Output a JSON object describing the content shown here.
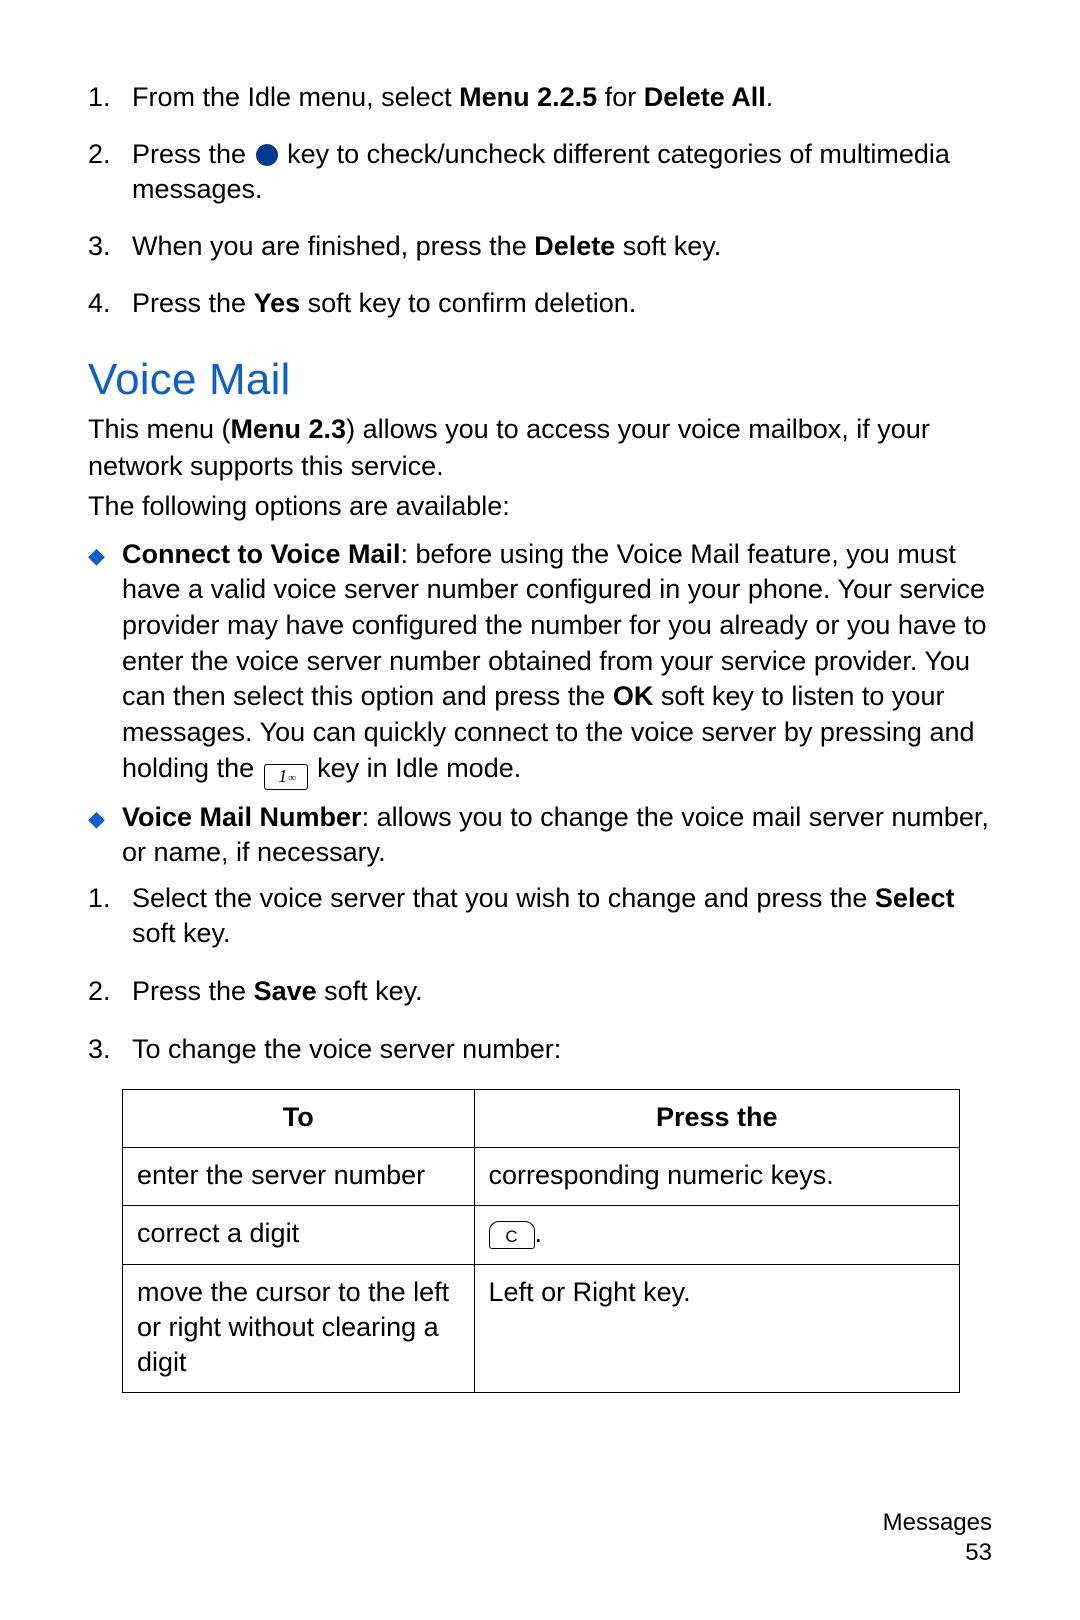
{
  "top_steps": [
    {
      "num": "1.",
      "parts": [
        {
          "t": "From the Idle menu, select "
        },
        {
          "t": "Menu 2.2.5",
          "b": true
        },
        {
          "t": " for "
        },
        {
          "t": "Delete All",
          "b": true
        },
        {
          "t": "."
        }
      ]
    },
    {
      "num": "2.",
      "parts": [
        {
          "t": "Press the "
        },
        {
          "icon": "circle"
        },
        {
          "t": " key to check/uncheck different categories of multimedia messages."
        }
      ]
    },
    {
      "num": "3.",
      "parts": [
        {
          "t": "When you are finished, press the "
        },
        {
          "t": "Delete",
          "b": true
        },
        {
          "t": " soft key."
        }
      ]
    },
    {
      "num": "4.",
      "parts": [
        {
          "t": "Press the "
        },
        {
          "t": "Yes",
          "b": true
        },
        {
          "t": " soft key to confirm deletion."
        }
      ]
    }
  ],
  "heading": "Voice Mail",
  "intro_parts": [
    {
      "t": "This menu ("
    },
    {
      "t": "Menu 2.3",
      "b": true
    },
    {
      "t": ") allows you to access your voice mailbox, if your network supports this service."
    }
  ],
  "intro2": "The following options are available:",
  "bullets": [
    {
      "parts": [
        {
          "t": "Connect to Voice Mail",
          "b": true
        },
        {
          "t": ": before using the Voice Mail feature, you must have a valid voice server number configured in your phone. Your service provider may have configured the number for you already or you have to enter the voice server number obtained from your service provider. You can then select this option and press the "
        },
        {
          "t": "OK",
          "b": true
        },
        {
          "t": " soft key to listen to your messages. You can quickly connect to the voice server by pressing and holding the "
        },
        {
          "icon": "one"
        },
        {
          "t": " key in Idle mode."
        }
      ]
    },
    {
      "parts": [
        {
          "t": "Voice Mail Number",
          "b": true
        },
        {
          "t": ": allows you to change the voice mail server number, or name, if necessary."
        }
      ]
    }
  ],
  "sub_steps": [
    {
      "num": "1.",
      "parts": [
        {
          "t": "Select the voice server that you wish to change and press the "
        },
        {
          "t": "Select",
          "b": true
        },
        {
          "t": " soft key."
        }
      ]
    },
    {
      "num": "2.",
      "parts": [
        {
          "t": "Press the "
        },
        {
          "t": "Save",
          "b": true
        },
        {
          "t": " soft key."
        }
      ]
    },
    {
      "num": "3.",
      "parts": [
        {
          "t": "To change the voice server number:"
        }
      ]
    }
  ],
  "table": {
    "headers": [
      "To",
      "Press the"
    ],
    "rows": [
      {
        "c1": [
          {
            "t": "enter the server number"
          }
        ],
        "c2": [
          {
            "t": "corresponding numeric keys."
          }
        ]
      },
      {
        "c1": [
          {
            "t": "correct a digit"
          }
        ],
        "c2": [
          {
            "icon": "c"
          },
          {
            "t": "."
          }
        ]
      },
      {
        "c1": [
          {
            "t": "move the cursor to the left or right without clearing a digit"
          }
        ],
        "c2": [
          {
            "t": "Left or Right key."
          }
        ]
      }
    ]
  },
  "footer": {
    "section": "Messages",
    "page": "53"
  }
}
